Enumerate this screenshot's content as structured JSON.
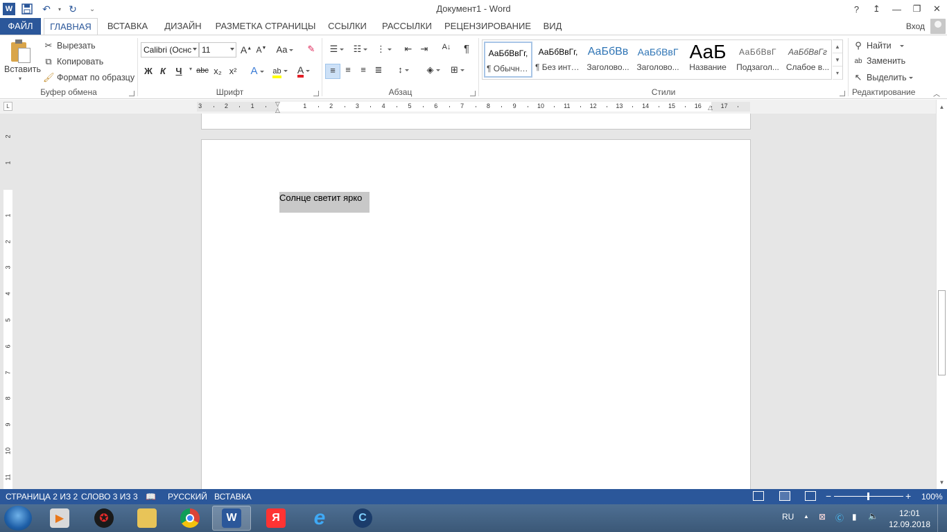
{
  "window": {
    "title": "Документ1 - Word",
    "help": "?",
    "controls": [
      "↥",
      "—",
      "❐",
      "✕"
    ]
  },
  "qat": {
    "undo": "↶",
    "redo": "↻",
    "more": "⌄"
  },
  "tabs": {
    "file": "ФАЙЛ",
    "home": "ГЛАВНАЯ",
    "insert": "ВСТАВКА",
    "design": "ДИЗАЙН",
    "layout": "РАЗМЕТКА СТРАНИЦЫ",
    "references": "ССЫЛКИ",
    "mailings": "РАССЫЛКИ",
    "review": "РЕЦЕНЗИРОВАНИЕ",
    "view": "ВИД",
    "signin": "Вход"
  },
  "clipboard": {
    "paste": "Вставить",
    "cut": "Вырезать",
    "copy": "Копировать",
    "format_painter": "Формат по образцу",
    "label": "Буфер обмена"
  },
  "font": {
    "name": "Calibri (Оснс",
    "size": "11",
    "grow": "A",
    "shrink": "A",
    "case": "Aa",
    "bold": "Ж",
    "italic": "К",
    "underline": "Ч",
    "strike": "abc",
    "subscript": "x₂",
    "superscript": "x²",
    "effects": "A",
    "highlight": "ab",
    "color": "A",
    "label": "Шрифт"
  },
  "paragraph": {
    "sort": "A↓",
    "pilcrow": "¶",
    "label": "Абзац"
  },
  "styles": {
    "items": [
      {
        "sample": "АаБбВвГг,",
        "name": "¶ Обычный"
      },
      {
        "sample": "АаБбВвГг,",
        "name": "¶ Без инте..."
      },
      {
        "sample": "АаБбВв",
        "name": "Заголово..."
      },
      {
        "sample": "АаБбВвГ",
        "name": "Заголово..."
      },
      {
        "sample": "АаБ",
        "name": "Название"
      },
      {
        "sample": "АаБбВвГ",
        "name": "Подзагол..."
      },
      {
        "sample": "АаБбВвГг",
        "name": "Слабое в..."
      }
    ],
    "label": "Стили"
  },
  "editing": {
    "find": "Найти",
    "replace": "Заменить",
    "select": "Выделить",
    "label": "Редактирование"
  },
  "ruler": {
    "numbers": [
      "3",
      "2",
      "1",
      "1",
      "2",
      "3",
      "4",
      "5",
      "6",
      "7",
      "8",
      "9",
      "10",
      "11",
      "12",
      "13",
      "14",
      "15",
      "16",
      "17"
    ],
    "vnumbers": [
      "2",
      "1",
      "1",
      "2",
      "3",
      "4",
      "5",
      "6",
      "7",
      "8",
      "9",
      "10",
      "11"
    ]
  },
  "document": {
    "text": "Солнце светит ярко"
  },
  "statusbar": {
    "page": "СТРАНИЦА 2 ИЗ 2",
    "words": "СЛОВО 3 ИЗ 3",
    "language": "РУССКИЙ",
    "mode": "ВСТАВКА",
    "zoom_minus": "−",
    "zoom_plus": "+",
    "zoom": "100%",
    "zoom_level_percent": 100
  },
  "taskbar": {
    "apps": [
      "media-player",
      "game-app",
      "file-explorer",
      "chrome",
      "word",
      "yandex-browser",
      "internet-explorer",
      "ccleaner"
    ],
    "word_glyph": "W",
    "yandex_glyph": "Я",
    "ie_glyph": "e",
    "lang": "RU",
    "time": "12:01",
    "date": "12.09.2018"
  }
}
